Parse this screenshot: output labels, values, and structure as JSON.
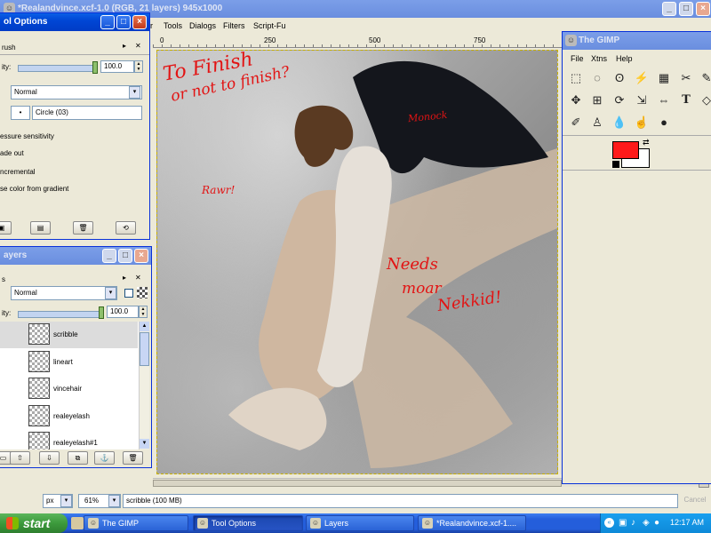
{
  "image_window": {
    "title": "*Realandvince.xcf-1.0 (RGB, 21 layers) 945x1000",
    "menu": [
      "r",
      "Tools",
      "Dialogs",
      "Filters",
      "Script-Fu"
    ],
    "ruler_marks": [
      "0",
      "250",
      "500",
      "750"
    ],
    "units": "px",
    "zoom": "61%",
    "status": "scribble (100 MB)",
    "cancel_label": "Cancel"
  },
  "canvas": {
    "annotations": {
      "to_finish_1": "To Finish",
      "to_finish_2": "or not to finish?",
      "monock": "Monock",
      "rawr": "Rawr!",
      "needs": "Needs",
      "moar": "moar",
      "nekkid": "Nekkid!"
    }
  },
  "tool_options": {
    "title": "ol Options",
    "tool_name": "rush",
    "opacity_label": "ity:",
    "opacity_value": "100.0",
    "mode_value": "Normal",
    "brush_value": "Circle (03)",
    "brush_glyph": "•",
    "checks": [
      "essure sensitivity",
      "ade out",
      "ncremental",
      "se color from gradient"
    ]
  },
  "layers": {
    "title": "ayers",
    "tab_label": "s",
    "mode_value": "Normal",
    "opacity_label": "ity:",
    "opacity_value": "100.0",
    "items": [
      "scribble",
      "lineart",
      "vincehair",
      "realeyelash",
      "realeyelash#1"
    ]
  },
  "toolbox": {
    "title": "The GIMP",
    "menu": [
      "File",
      "Xtns",
      "Help"
    ],
    "fg_color": "#ff1a1a",
    "bg_color": "#ffffff"
  },
  "taskbar": {
    "start_label": "start",
    "tasks": [
      "The GIMP",
      "Tool Options",
      "Layers",
      "*Realandvince.xcf-1...."
    ],
    "clock": "12:17 AM"
  },
  "colors": {
    "xp_blue": "#0046d5",
    "taskbar": "#245edb",
    "start_green": "#3c9a3c",
    "annotation_red": "#e21414"
  }
}
